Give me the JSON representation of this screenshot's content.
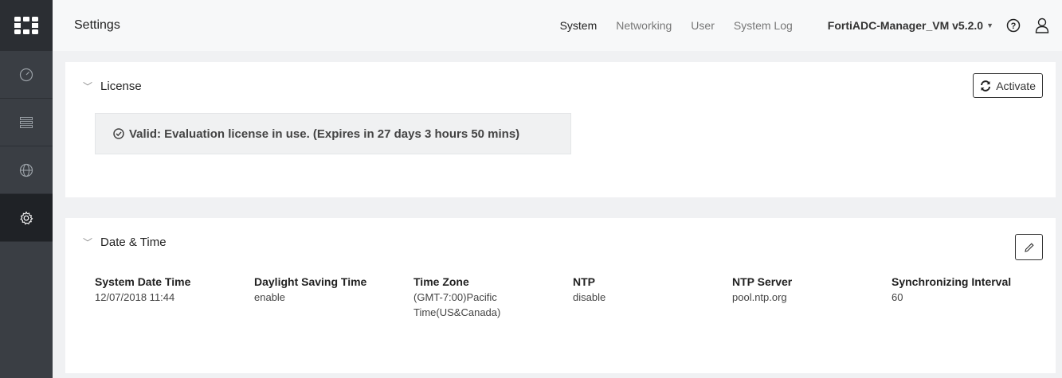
{
  "sidebar": {
    "items": [
      {
        "icon": "dashboard-icon"
      },
      {
        "icon": "devices-icon"
      },
      {
        "icon": "globe-icon"
      },
      {
        "icon": "gear-icon",
        "active": true
      }
    ]
  },
  "header": {
    "title": "Settings",
    "tabs": [
      {
        "label": "System",
        "active": true
      },
      {
        "label": "Networking"
      },
      {
        "label": "User"
      },
      {
        "label": "System Log"
      }
    ],
    "product": "FortiADC-Manager_VM v5.2.0"
  },
  "license": {
    "title": "License",
    "activate_label": "Activate",
    "status": "Valid: Evaluation license in use. (Expires in 27 days 3 hours 50 mins)"
  },
  "datetime": {
    "title": "Date & Time",
    "fields": [
      {
        "label": "System Date Time",
        "value": "12/07/2018 11:44"
      },
      {
        "label": "Daylight Saving Time",
        "value": "enable"
      },
      {
        "label": "Time Zone",
        "value": "(GMT-7:00)Pacific Time(US&Canada)"
      },
      {
        "label": "NTP",
        "value": "disable"
      },
      {
        "label": "NTP Server",
        "value": "pool.ntp.org"
      },
      {
        "label": "Synchronizing Interval",
        "value": "60"
      }
    ]
  },
  "colors": {
    "sidebar": "#3a3e44",
    "sidebar_active": "#1f2226",
    "background": "#f0f1f3"
  }
}
